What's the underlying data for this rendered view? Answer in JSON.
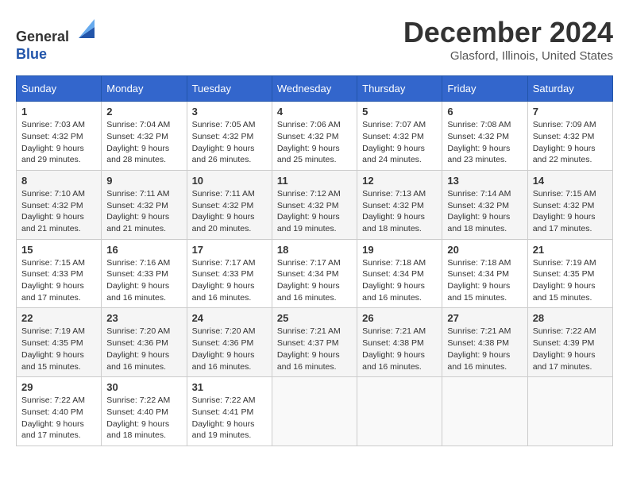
{
  "header": {
    "logo_line1": "General",
    "logo_line2": "Blue",
    "title": "December 2024",
    "subtitle": "Glasford, Illinois, United States"
  },
  "weekdays": [
    "Sunday",
    "Monday",
    "Tuesday",
    "Wednesday",
    "Thursday",
    "Friday",
    "Saturday"
  ],
  "weeks": [
    [
      {
        "day": "1",
        "sunrise": "7:03 AM",
        "sunset": "4:32 PM",
        "daylight": "9 hours and 29 minutes."
      },
      {
        "day": "2",
        "sunrise": "7:04 AM",
        "sunset": "4:32 PM",
        "daylight": "9 hours and 28 minutes."
      },
      {
        "day": "3",
        "sunrise": "7:05 AM",
        "sunset": "4:32 PM",
        "daylight": "9 hours and 26 minutes."
      },
      {
        "day": "4",
        "sunrise": "7:06 AM",
        "sunset": "4:32 PM",
        "daylight": "9 hours and 25 minutes."
      },
      {
        "day": "5",
        "sunrise": "7:07 AM",
        "sunset": "4:32 PM",
        "daylight": "9 hours and 24 minutes."
      },
      {
        "day": "6",
        "sunrise": "7:08 AM",
        "sunset": "4:32 PM",
        "daylight": "9 hours and 23 minutes."
      },
      {
        "day": "7",
        "sunrise": "7:09 AM",
        "sunset": "4:32 PM",
        "daylight": "9 hours and 22 minutes."
      }
    ],
    [
      {
        "day": "8",
        "sunrise": "7:10 AM",
        "sunset": "4:32 PM",
        "daylight": "9 hours and 21 minutes."
      },
      {
        "day": "9",
        "sunrise": "7:11 AM",
        "sunset": "4:32 PM",
        "daylight": "9 hours and 21 minutes."
      },
      {
        "day": "10",
        "sunrise": "7:11 AM",
        "sunset": "4:32 PM",
        "daylight": "9 hours and 20 minutes."
      },
      {
        "day": "11",
        "sunrise": "7:12 AM",
        "sunset": "4:32 PM",
        "daylight": "9 hours and 19 minutes."
      },
      {
        "day": "12",
        "sunrise": "7:13 AM",
        "sunset": "4:32 PM",
        "daylight": "9 hours and 18 minutes."
      },
      {
        "day": "13",
        "sunrise": "7:14 AM",
        "sunset": "4:32 PM",
        "daylight": "9 hours and 18 minutes."
      },
      {
        "day": "14",
        "sunrise": "7:15 AM",
        "sunset": "4:32 PM",
        "daylight": "9 hours and 17 minutes."
      }
    ],
    [
      {
        "day": "15",
        "sunrise": "7:15 AM",
        "sunset": "4:33 PM",
        "daylight": "9 hours and 17 minutes."
      },
      {
        "day": "16",
        "sunrise": "7:16 AM",
        "sunset": "4:33 PM",
        "daylight": "9 hours and 16 minutes."
      },
      {
        "day": "17",
        "sunrise": "7:17 AM",
        "sunset": "4:33 PM",
        "daylight": "9 hours and 16 minutes."
      },
      {
        "day": "18",
        "sunrise": "7:17 AM",
        "sunset": "4:34 PM",
        "daylight": "9 hours and 16 minutes."
      },
      {
        "day": "19",
        "sunrise": "7:18 AM",
        "sunset": "4:34 PM",
        "daylight": "9 hours and 16 minutes."
      },
      {
        "day": "20",
        "sunrise": "7:18 AM",
        "sunset": "4:34 PM",
        "daylight": "9 hours and 15 minutes."
      },
      {
        "day": "21",
        "sunrise": "7:19 AM",
        "sunset": "4:35 PM",
        "daylight": "9 hours and 15 minutes."
      }
    ],
    [
      {
        "day": "22",
        "sunrise": "7:19 AM",
        "sunset": "4:35 PM",
        "daylight": "9 hours and 15 minutes."
      },
      {
        "day": "23",
        "sunrise": "7:20 AM",
        "sunset": "4:36 PM",
        "daylight": "9 hours and 16 minutes."
      },
      {
        "day": "24",
        "sunrise": "7:20 AM",
        "sunset": "4:36 PM",
        "daylight": "9 hours and 16 minutes."
      },
      {
        "day": "25",
        "sunrise": "7:21 AM",
        "sunset": "4:37 PM",
        "daylight": "9 hours and 16 minutes."
      },
      {
        "day": "26",
        "sunrise": "7:21 AM",
        "sunset": "4:38 PM",
        "daylight": "9 hours and 16 minutes."
      },
      {
        "day": "27",
        "sunrise": "7:21 AM",
        "sunset": "4:38 PM",
        "daylight": "9 hours and 16 minutes."
      },
      {
        "day": "28",
        "sunrise": "7:22 AM",
        "sunset": "4:39 PM",
        "daylight": "9 hours and 17 minutes."
      }
    ],
    [
      {
        "day": "29",
        "sunrise": "7:22 AM",
        "sunset": "4:40 PM",
        "daylight": "9 hours and 17 minutes."
      },
      {
        "day": "30",
        "sunrise": "7:22 AM",
        "sunset": "4:40 PM",
        "daylight": "9 hours and 18 minutes."
      },
      {
        "day": "31",
        "sunrise": "7:22 AM",
        "sunset": "4:41 PM",
        "daylight": "9 hours and 19 minutes."
      },
      null,
      null,
      null,
      null
    ]
  ]
}
